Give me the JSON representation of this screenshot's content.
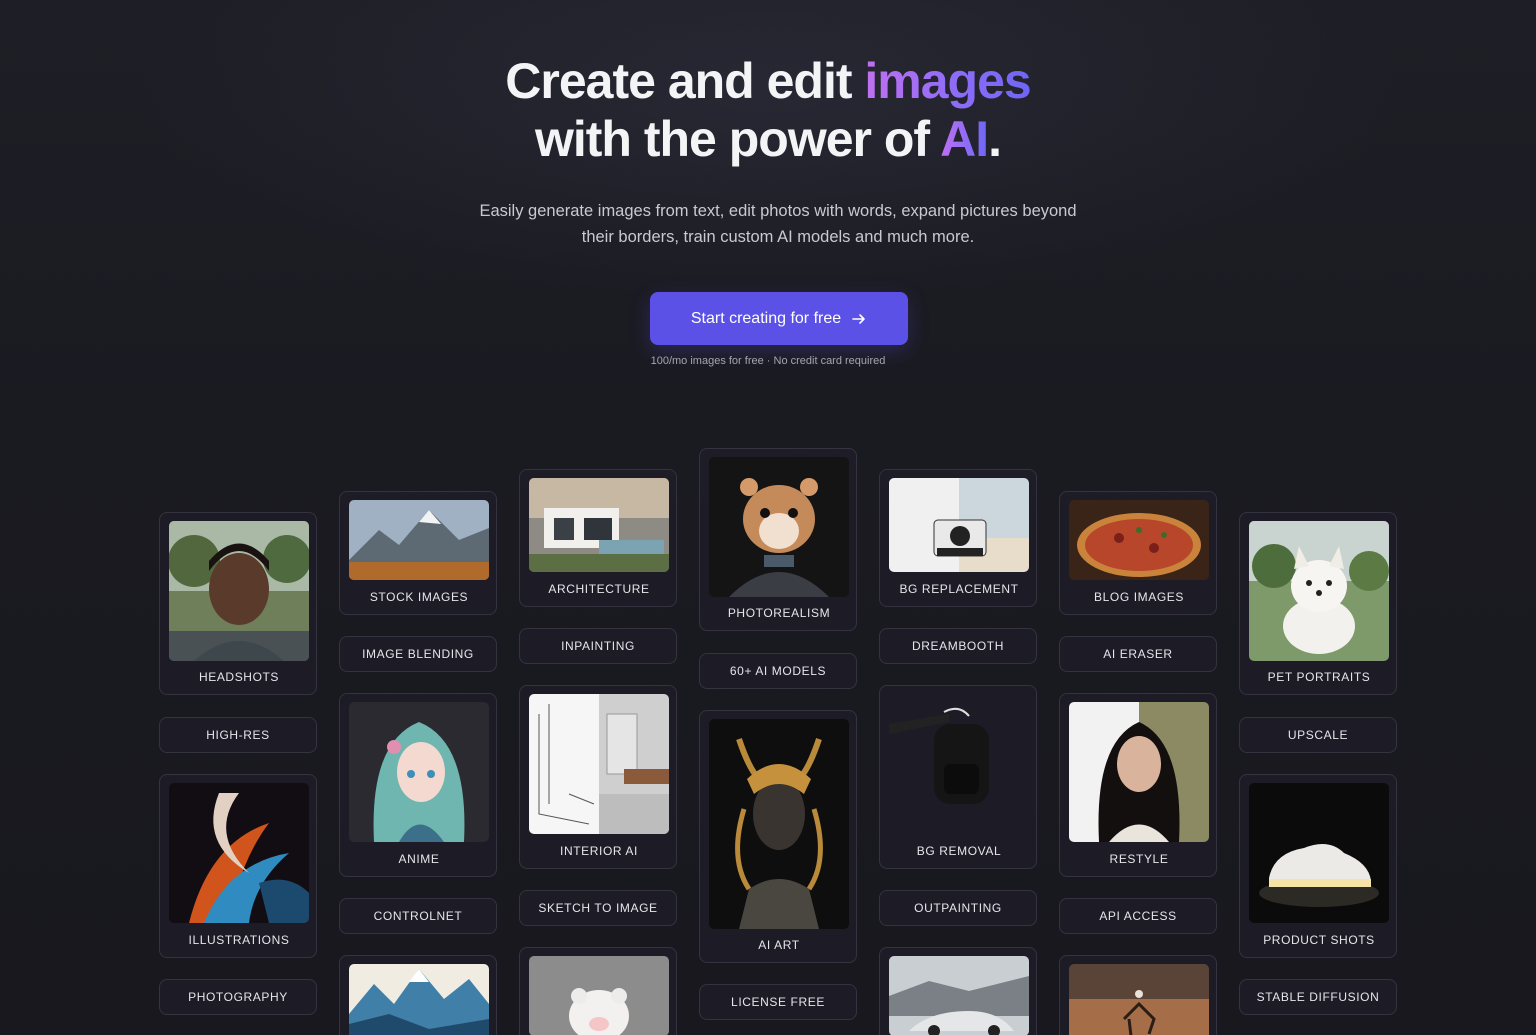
{
  "hero": {
    "title_line1_plain": "Create and edit ",
    "title_line1_accent": "images",
    "title_line2_plain": "with the power of ",
    "title_line2_accent": "AI",
    "title_line2_end": ".",
    "subtitle": "Easily generate images from text, edit photos with words, expand pictures beyond their borders, train custom AI models and much more.",
    "cta_label": "Start creating for free",
    "note": "100/mo images for free · No credit card required"
  },
  "colors": {
    "accent_purple": "#8a6cf7",
    "button": "#5b51e6",
    "background": "#1b1b22"
  },
  "features": {
    "col1": {
      "card1": "HEADSHOTS",
      "pill1": "HIGH-RES",
      "card2": "ILLUSTRATIONS",
      "pill2": "PHOTOGRAPHY"
    },
    "col2": {
      "card1": "STOCK IMAGES",
      "pill1": "IMAGE BLENDING",
      "card2": "ANIME",
      "pill2": "CONTROLNET"
    },
    "col3": {
      "card1": "ARCHITECTURE",
      "pill1": "INPAINTING",
      "card2": "INTERIOR AI",
      "pill2": "SKETCH TO IMAGE"
    },
    "col4": {
      "card1": "PHOTOREALISM",
      "pill1": "60+ AI MODELS",
      "card2": "AI ART",
      "pill2": "LICENSE FREE"
    },
    "col5": {
      "card1": "BG REPLACEMENT",
      "pill1": "DREAMBOOTH",
      "card2": "BG REMOVAL",
      "pill2": "OUTPAINTING"
    },
    "col6": {
      "card1": "BLOG IMAGES",
      "pill1": "AI ERASER",
      "card2": "RESTYLE",
      "pill2": "API ACCESS"
    },
    "col7": {
      "card1": "PET PORTRAITS",
      "pill1": "UPSCALE",
      "card2": "PRODUCT SHOTS",
      "pill2": "STABLE DIFFUSION"
    }
  }
}
